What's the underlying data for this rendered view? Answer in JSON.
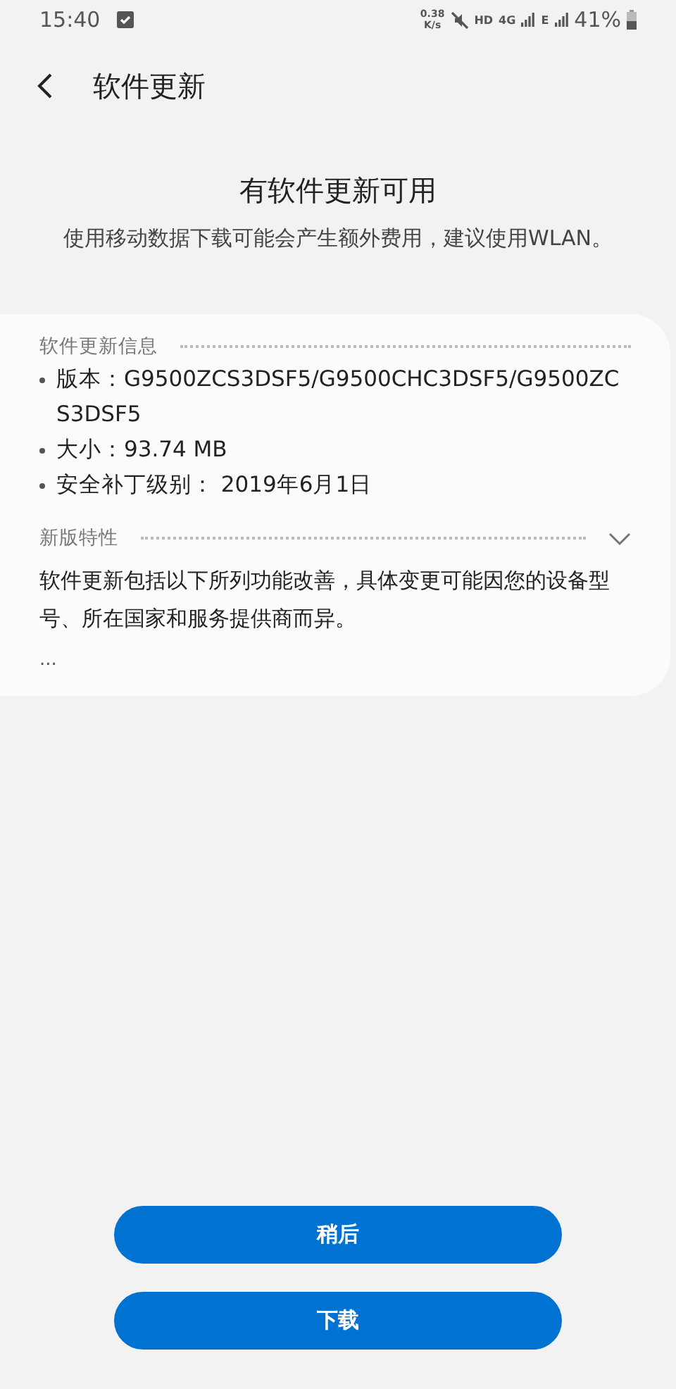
{
  "status_bar": {
    "time": "15:40",
    "speed_value": "0.38",
    "speed_unit": "K/s",
    "hd": "HD",
    "network_1": "4G",
    "network_2": "E",
    "battery": "41%"
  },
  "header": {
    "title": "软件更新"
  },
  "notice": {
    "title": "有软件更新可用",
    "message": "使用移动数据下载可能会产生额外费用，建议使用WLAN。"
  },
  "card": {
    "info_heading": "软件更新信息",
    "info_items": [
      "版本：G9500ZCS3DSF5/G9500CHC3DSF5/G9500ZCS3DSF5",
      "大小：93.74 MB",
      "安全补丁级别： 2019年6月1日"
    ],
    "features_heading": "新版特性",
    "features_text": "软件更新包括以下所列功能改善，具体变更可能因您的设备型号、所在国家和服务提供商而异。",
    "ellipsis": "..."
  },
  "buttons": [
    "稍后",
    "下载"
  ]
}
